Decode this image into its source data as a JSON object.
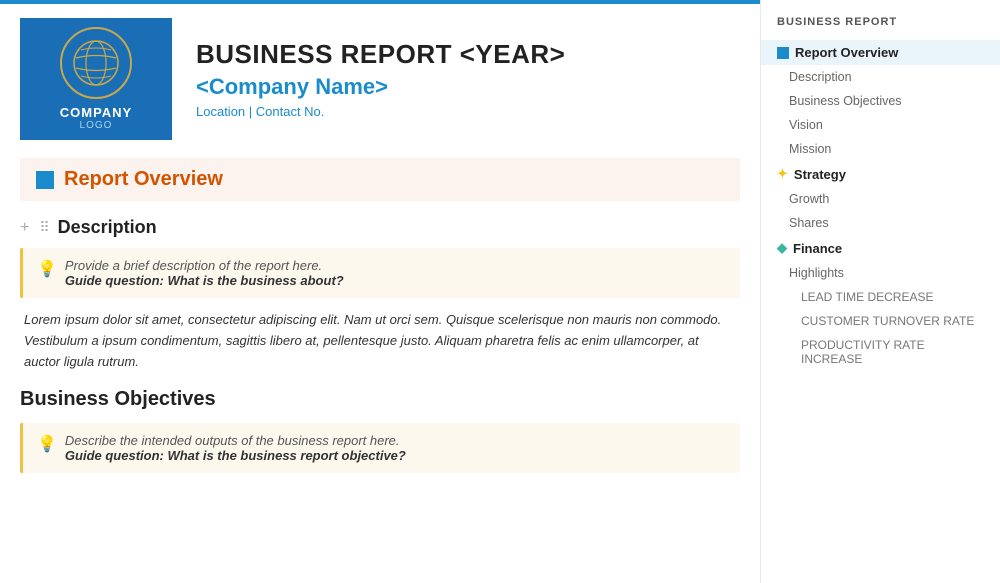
{
  "header": {
    "report_title": "BUSINESS REPORT <YEAR>",
    "company_name": "<Company Name>",
    "location_contact": "Location | Contact No.",
    "logo_company": "COMPANY",
    "logo_sub": "LOGO"
  },
  "section_overview": {
    "title": "Report Overview"
  },
  "description": {
    "title": "Description",
    "hint_line1": "Provide a brief description of the report here.",
    "hint_line2": "Guide question: What is the business about?",
    "body_text": "Lorem ipsum dolor sit amet, consectetur adipiscing elit. Nam ut orci sem. Quisque scelerisque non mauris non commodo. Vestibulum a ipsum condimentum, sagittis libero at, pellentesque justo. Aliquam pharetra felis ac enim ullamcorper, at auctor ligula rutrum."
  },
  "business_objectives": {
    "title": "Business Objectives",
    "hint_line1": "Describe the intended outputs of the business report here.",
    "hint_line2": "Guide question: What is the business report objective?"
  },
  "sidebar": {
    "header": "BUSINESS REPORT",
    "items": [
      {
        "label": "Report Overview",
        "type": "section-active",
        "icon": "blue-square"
      },
      {
        "label": "Description",
        "type": "sub"
      },
      {
        "label": "Business Objectives",
        "type": "sub"
      },
      {
        "label": "Vision",
        "type": "sub"
      },
      {
        "label": "Mission",
        "type": "sub"
      },
      {
        "label": "Strategy",
        "type": "section",
        "icon": "star"
      },
      {
        "label": "Growth",
        "type": "sub"
      },
      {
        "label": "Shares",
        "type": "sub"
      },
      {
        "label": "Finance",
        "type": "section",
        "icon": "diamond"
      },
      {
        "label": "Highlights",
        "type": "sub"
      },
      {
        "label": "LEAD TIME DECREASE",
        "type": "sub-sub"
      },
      {
        "label": "CUSTOMER TURNOVER RATE",
        "type": "sub-sub"
      },
      {
        "label": "PRODUCTIVITY RATE INCREASE",
        "type": "sub-sub"
      }
    ]
  }
}
